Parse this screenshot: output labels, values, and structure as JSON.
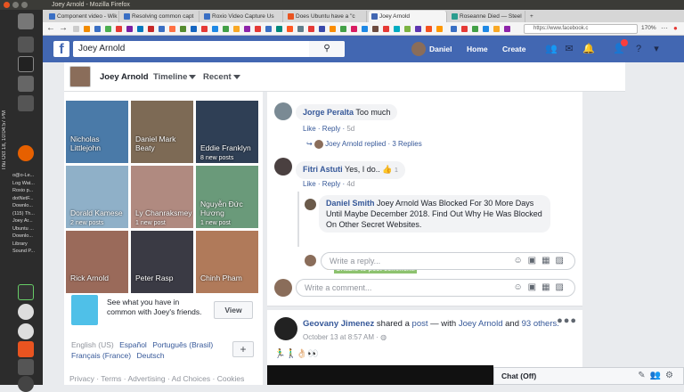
{
  "window_title": "Joey Arnold - Mozilla Firefox",
  "desktop": {
    "clock": "Thu Oct 18, 10:04:57 PM",
    "open_windows": [
      "o@o-Le...",
      "Log Wat...",
      "Roxio p...",
      "dotNetF...",
      "Downlo...",
      "(115) Th...",
      "Joey Ar...",
      "Ubuntu ...",
      "Downlo...",
      "Library",
      "Sound P..."
    ]
  },
  "tabs": [
    {
      "label": "Component video - Wik",
      "active": false,
      "color": "#3a6fc4"
    },
    {
      "label": "Resolving common capt",
      "active": false,
      "color": "#3a6fc4"
    },
    {
      "label": "Roxio Video Capture Us",
      "active": false,
      "color": "#3a6fc4"
    },
    {
      "label": "Does Ubuntu have a \"c",
      "active": false,
      "color": "#e95420"
    },
    {
      "label": "Joey Arnold",
      "active": true,
      "color": "#4267b2"
    },
    {
      "label": "Roseanne Died — Steel",
      "active": false,
      "color": "#2a9d8f"
    },
    {
      "label": "+",
      "active": false,
      "color": ""
    }
  ],
  "url": "https://www.facebook.c",
  "zoom": "170%",
  "fb": {
    "search_value": "Joey Arnold",
    "nav_user": "Daniel",
    "nav_home": "Home",
    "nav_create": "Create"
  },
  "profile": {
    "name": "Joey Arnold",
    "tab_timeline": "Timeline",
    "tab_recent": "Recent"
  },
  "friends": [
    {
      "name": "Nicholas Littlejohn",
      "sub": "",
      "color": "#4a7aa8"
    },
    {
      "name": "Daniel Mark Beaty",
      "sub": "",
      "color": "#7d6a55"
    },
    {
      "name": "Eddie Franklyn",
      "sub": "8 new posts",
      "color": "#2f3f55"
    },
    {
      "name": "Dorald Kamese",
      "sub": "2 new posts",
      "color": "#8fb0c8"
    },
    {
      "name": "Ly Chanraksmey",
      "sub": "1 new post",
      "color": "#b08a80"
    },
    {
      "name": "Nguyễn Đức Hương",
      "sub": "1 new post",
      "color": "#6a9a7a"
    },
    {
      "name": "Rick Arnold",
      "sub": "",
      "color": "#9a6a5a"
    },
    {
      "name": "Peter Rasp",
      "sub": "",
      "color": "#3a3a44"
    },
    {
      "name": "Chinh Pham",
      "sub": "",
      "color": "#b07a5a"
    }
  ],
  "suggest": {
    "text": "See what you have in common with Joey's friends.",
    "button": "View"
  },
  "languages": {
    "current": "English (US)",
    "others": [
      "Español",
      "Português (Brasil)",
      "Français (France)",
      "Deutsch"
    ],
    "plus": "+"
  },
  "footer": {
    "links": [
      "Privacy",
      "Terms",
      "Advertising",
      "Ad Choices",
      "Cookies"
    ]
  },
  "comments": {
    "c1": {
      "name": "Jorge Peralta",
      "text": "Too much",
      "like": "Like",
      "reply": "Reply",
      "time": "5d",
      "replier": "Joey Arnold",
      "replied": "replied",
      "replies": "3 Replies"
    },
    "c2": {
      "name": "Fitri Astuti",
      "text": "Yes, I do..",
      "reactions": "1",
      "like": "Like",
      "reply": "Reply",
      "time": "4d"
    },
    "c3": {
      "name": "Daniel Smith",
      "text": "Joey Arnold Was Blocked For 30 More Days Until Maybe December 2018. Find Out Why He Was Blocked On Other Secret Websites.",
      "warning": "Unable to post comment."
    },
    "reply_placeholder": "Write a reply...",
    "comment_placeholder": "Write a comment..."
  },
  "post2": {
    "author": "Geovany Jimenez",
    "shared": "shared a",
    "post": "post",
    "with": "— with",
    "tagged": "Joey Arnold",
    "and": "and",
    "others": "93 others.",
    "date": "October 13 at 8:57 AM ·",
    "emoji": "🏃‍♂️🚶‍♂️👌🏻👀"
  },
  "chat": {
    "label": "Chat (Off)"
  }
}
